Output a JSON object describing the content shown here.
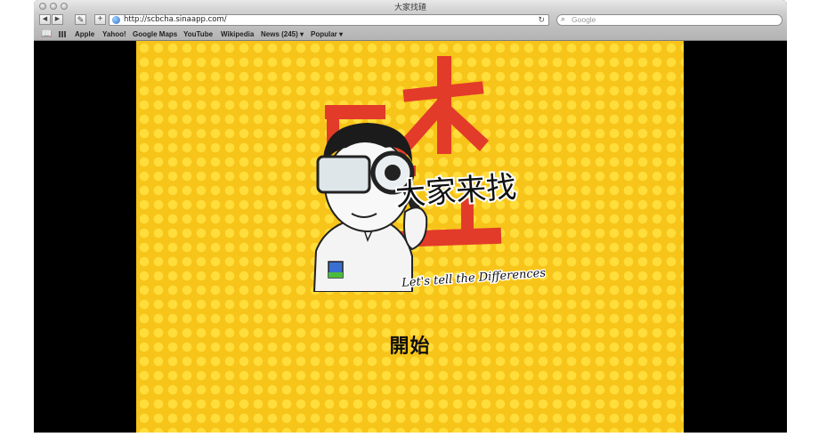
{
  "window": {
    "title": "大家找碴"
  },
  "toolbar": {
    "back_label": "◀",
    "forward_label": "▶",
    "add_label": "+",
    "url": "http://scbcha.sinaapp.com/",
    "search_placeholder": "Google"
  },
  "bookmarks": [
    {
      "label": "Apple"
    },
    {
      "label": "Yahoo!"
    },
    {
      "label": "Google Maps"
    },
    {
      "label": "YouTube"
    },
    {
      "label": "Wikipedia"
    },
    {
      "label": "News (245)"
    },
    {
      "label": "Popular"
    }
  ],
  "game": {
    "logo_chars": "大家来找",
    "logo_big_char": "碴",
    "tagline": "Let's tell the Differences!",
    "start_label": "開始"
  },
  "colors": {
    "game_bg": "#f7c41a",
    "dot": "#ffdd3b",
    "logo_red": "#e23b2a"
  }
}
